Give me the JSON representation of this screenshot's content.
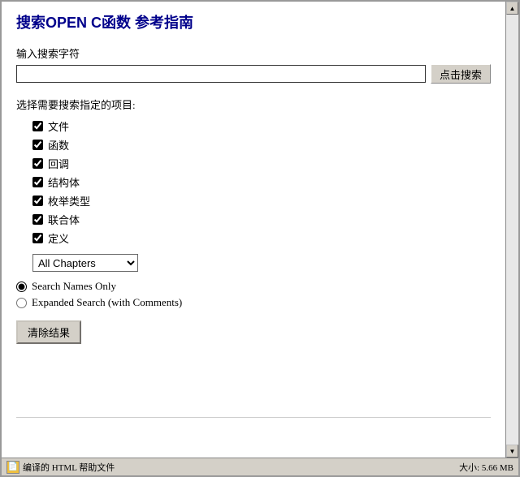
{
  "title": "搜索OPEN C函数 参考指南",
  "search": {
    "label": "输入搜索字符",
    "placeholder": "",
    "button_label": "点击搜索"
  },
  "filter": {
    "section_label": "选择需要搜索指定的项目:",
    "items": [
      {
        "id": "files",
        "label": "文件",
        "checked": true
      },
      {
        "id": "functions",
        "label": "函数",
        "checked": true
      },
      {
        "id": "callbacks",
        "label": "回调",
        "checked": true
      },
      {
        "id": "structures",
        "label": "结构体",
        "checked": true
      },
      {
        "id": "enum_types",
        "label": "枚举类型",
        "checked": true
      },
      {
        "id": "unions",
        "label": "联合体",
        "checked": true
      },
      {
        "id": "definitions",
        "label": "定义",
        "checked": true
      }
    ]
  },
  "chapter_select": {
    "options": [
      "All Chapters"
    ],
    "selected": "All Chapters"
  },
  "search_mode": {
    "options": [
      {
        "id": "names_only",
        "label": "Search Names Only",
        "selected": true
      },
      {
        "id": "expanded",
        "label": "Expanded Search (with Comments)",
        "selected": false
      }
    ]
  },
  "clear_button_label": "清除结果",
  "statusbar": {
    "text": "编译的 HTML 帮助文件",
    "size": "大小: 5.66 MB"
  }
}
